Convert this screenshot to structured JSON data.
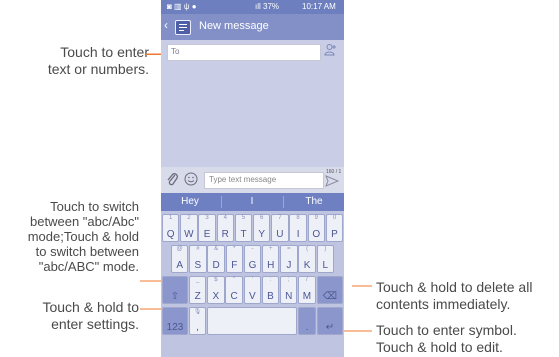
{
  "status_bar": {
    "left_icons": "◙ ▥ ψ ●",
    "signal": "ıll 37%",
    "time": "10:17 AM"
  },
  "header": {
    "back_glyph": "‹",
    "title": "New message"
  },
  "to_field": {
    "placeholder": "To"
  },
  "compose": {
    "placeholder": "Type text message",
    "counter": "160 / 1"
  },
  "suggestions": [
    "Hey",
    "I",
    "The"
  ],
  "keyboard": {
    "row1": [
      {
        "c": "Q",
        "s": "1"
      },
      {
        "c": "W",
        "s": "2"
      },
      {
        "c": "E",
        "s": "3"
      },
      {
        "c": "R",
        "s": "4"
      },
      {
        "c": "T",
        "s": "5"
      },
      {
        "c": "Y",
        "s": "6"
      },
      {
        "c": "U",
        "s": "7"
      },
      {
        "c": "I",
        "s": "8"
      },
      {
        "c": "O",
        "s": "9"
      },
      {
        "c": "P",
        "s": "0"
      }
    ],
    "row2": [
      {
        "c": "A",
        "s": "@"
      },
      {
        "c": "S",
        "s": "#"
      },
      {
        "c": "D",
        "s": "&"
      },
      {
        "c": "F",
        "s": "*"
      },
      {
        "c": "G",
        "s": "-"
      },
      {
        "c": "H",
        "s": "+"
      },
      {
        "c": "J",
        "s": "="
      },
      {
        "c": "K",
        "s": "("
      },
      {
        "c": "L",
        "s": ")"
      }
    ],
    "row3": [
      {
        "c": "Z",
        "s": "_"
      },
      {
        "c": "X",
        "s": "$"
      },
      {
        "c": "C",
        "s": "\""
      },
      {
        "c": "V",
        "s": "'"
      },
      {
        "c": "B",
        "s": ":"
      },
      {
        "c": "N",
        "s": ";"
      },
      {
        "c": "M",
        "s": "/"
      }
    ],
    "shift_glyph": "⇧",
    "delete_glyph": "⌫",
    "settings_label": "123",
    "mic_glyph": "🎙",
    "comma": ",",
    "period": ".",
    "symbol_glyph": "♂",
    "enter_glyph": "↵"
  },
  "callouts": {
    "enter_text": [
      "Touch to enter",
      "text or numbers."
    ],
    "switch_case": [
      "Touch to switch",
      "between \"abc/Abc\"",
      "mode;Touch & hold",
      "to switch between",
      "\"abc/ABC\" mode."
    ],
    "settings": [
      "Touch & hold to",
      "enter settings."
    ],
    "delete_all": [
      "Touch & hold to delete all",
      "contents immediately."
    ],
    "symbol": [
      "Touch to enter symbol.",
      "Touch & hold to edit."
    ]
  },
  "colors": {
    "accent": "#f07a2c",
    "statusbar": "#6d7fbf",
    "suggest_bar": "#6e80c2"
  }
}
